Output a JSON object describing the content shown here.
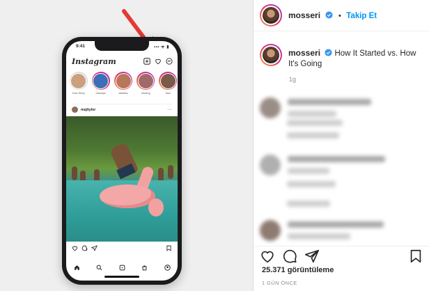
{
  "phone": {
    "time": "9:41",
    "signal": "▪▪▪ ᯤ ▮",
    "logo": "Instagram",
    "stories": [
      {
        "name": "Your Story"
      },
      {
        "name": "nissmyc"
      },
      {
        "name": "arbales"
      },
      {
        "name": "mnning"
      },
      {
        "name": "dmc"
      }
    ],
    "post_user": "mqltyler",
    "more": "···"
  },
  "post": {
    "username": "mosseri",
    "separator": "•",
    "follow_label": "Takip Et",
    "caption": "How It Started vs. How It's Going",
    "caption_age": "1g",
    "views": "25.371 görüntüleme",
    "posted_ago": "1 GÜN ÖNCE"
  },
  "icons": {
    "annotation": "red-arrow-icon",
    "verified": "verified-badge-icon",
    "like": "heart-icon",
    "comment": "comment-icon",
    "share": "share-icon",
    "save": "bookmark-icon"
  },
  "colors": {
    "follow_blue": "#0095f6",
    "verified_blue": "#3897f0",
    "arrow_red": "#e53935",
    "story_gradient": [
      "#f9a23c",
      "#e1306c",
      "#a233c8"
    ]
  }
}
